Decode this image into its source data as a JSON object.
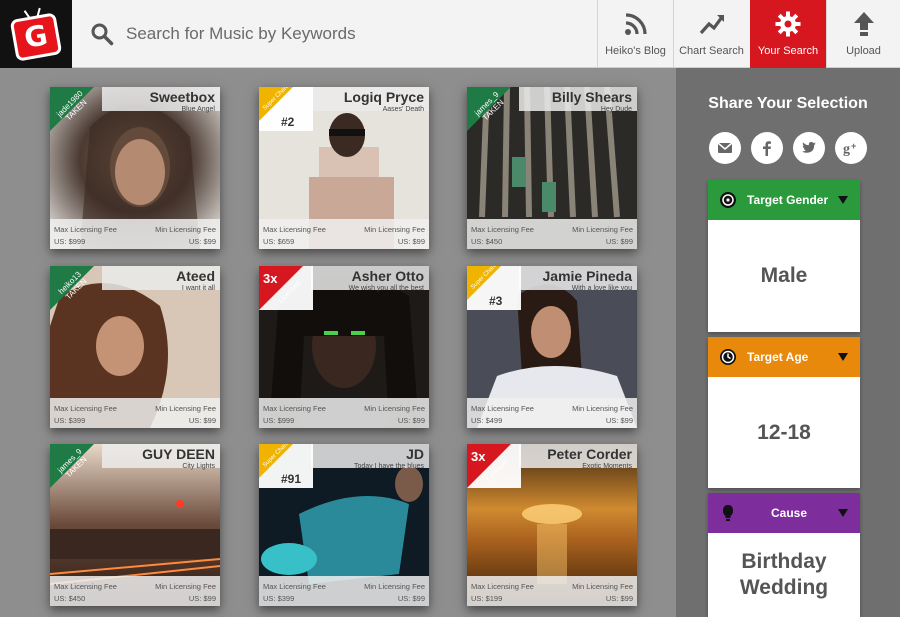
{
  "app": {
    "logo_letter": "G"
  },
  "search": {
    "placeholder": "Search for Music by Keywords"
  },
  "nav": [
    {
      "label": "Heiko's Blog",
      "icon": "rss-icon"
    },
    {
      "label": "Chart Search",
      "icon": "trend-up-icon"
    },
    {
      "label": "Your Search",
      "icon": "gear-icon",
      "active": true
    },
    {
      "label": "Upload",
      "icon": "upload-arrow-icon"
    }
  ],
  "cards": [
    {
      "name": "Sweetbox",
      "subtitle": "Blue Angel",
      "tag_type": "taken",
      "tag_user": "jade1980",
      "tag_label": "TAKEN",
      "max_label": "Max Licensing Fee",
      "max_price": "US: $999",
      "min_label": "Min Licensing Fee",
      "min_price": "US: $99"
    },
    {
      "name": "Logiq Pryce",
      "subtitle": "Aases' Death",
      "tag_type": "chart",
      "tag_label": "Super Chart",
      "rank": "#2",
      "max_label": "Max Licensing Fee",
      "max_price": "US: $659",
      "min_label": "Min Licensing Fee",
      "min_price": "US: $99"
    },
    {
      "name": "Billy Shears",
      "subtitle": "Hey Dude",
      "tag_type": "taken",
      "tag_user": "james_9",
      "tag_label": "TAKEN",
      "max_label": "Max Licensing Fee",
      "max_price": "US: $450",
      "min_label": "Min Licensing Fee",
      "min_price": "US: $99"
    },
    {
      "name": "Ateed",
      "subtitle": "I want it all",
      "tag_type": "taken",
      "tag_user": "heiko13",
      "tag_label": "TAKEN",
      "max_label": "Max Licensing Fee",
      "max_price": "US: $399",
      "min_label": "Min Licensing Fee",
      "min_price": "US: $99"
    },
    {
      "name": "Asher Otto",
      "subtitle": "We wish you all the best",
      "tag_type": "licensed",
      "times": "3x",
      "tag_label": "Licensed",
      "max_label": "Max Licensing Fee",
      "max_price": "US: $999",
      "min_label": "Min Licensing Fee",
      "min_price": "US: $99"
    },
    {
      "name": "Jamie Pineda",
      "subtitle": "With a love like you",
      "tag_type": "chart",
      "tag_label": "Super Chart",
      "rank": "#3",
      "max_label": "Max Licensing Fee",
      "max_price": "US: $499",
      "min_label": "Min Licensing Fee",
      "min_price": "US: $99"
    },
    {
      "name": "GUY DEEN",
      "subtitle": "City Lights",
      "tag_type": "taken",
      "tag_user": "james_9",
      "tag_label": "TAKEN",
      "max_label": "Max Licensing Fee",
      "max_price": "US: $450",
      "min_label": "Min Licensing Fee",
      "min_price": "US: $99"
    },
    {
      "name": "JD",
      "subtitle": "Today I have the blues",
      "tag_type": "chart",
      "tag_label": "Super Chart",
      "rank": "#91",
      "max_label": "Max Licensing Fee",
      "max_price": "US: $399",
      "min_label": "Min Licensing Fee",
      "min_price": "US: $99"
    },
    {
      "name": "Peter Corder",
      "subtitle": "Exotic Moments",
      "tag_type": "licensed",
      "times": "3x",
      "tag_label": "Licensed",
      "max_label": "Max Licensing Fee",
      "max_price": "US: $199",
      "min_label": "Min Licensing Fee",
      "min_price": "US: $99"
    }
  ],
  "sidebar": {
    "title": "Share Your Selection",
    "social": [
      "email-icon",
      "facebook-icon",
      "twitter-icon",
      "google-plus-icon"
    ],
    "panels": [
      {
        "label": "Target Gender",
        "value": "Male",
        "color": "#2b9a3c",
        "icon": "target-icon"
      },
      {
        "label": "Target Age",
        "value": "12-18",
        "color": "#e8890c",
        "icon": "clock-icon"
      },
      {
        "label": "Cause",
        "value": "Birthday\nWedding",
        "color": "#7d2d9c",
        "icon": "lightbulb-icon"
      }
    ]
  },
  "colors": {
    "accent": "#d7171f",
    "taken": "#1f7a45",
    "chart": "#f0b400",
    "licensed": "#d7171f"
  }
}
